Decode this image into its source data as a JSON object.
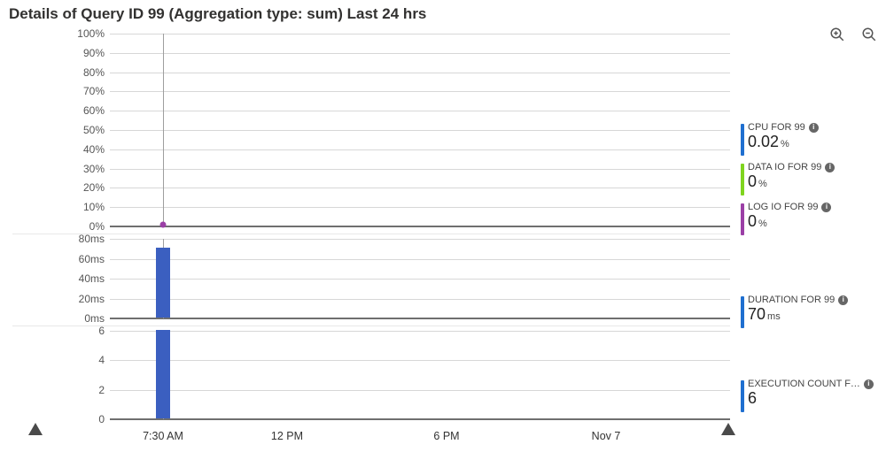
{
  "title": "Details of Query ID 99 (Aggregation type: sum) Last 24 hrs",
  "zoom_in_name": "zoom-in-icon",
  "zoom_out_name": "zoom-out-icon",
  "x_axis": {
    "labels": [
      "7:30 AM",
      "12 PM",
      "6 PM",
      "Nov 7"
    ]
  },
  "metrics": [
    {
      "label": "CPU FOR 99",
      "value": "0.02",
      "unit": "%",
      "color": "#1f6fd0"
    },
    {
      "label": "DATA IO FOR 99",
      "value": "0",
      "unit": "%",
      "color": "#7fd41e"
    },
    {
      "label": "LOG IO FOR 99",
      "value": "0",
      "unit": "%",
      "color": "#9b3fa6"
    },
    {
      "label": "DURATION FOR 99",
      "value": "70",
      "unit": "ms",
      "color": "#1f6fd0"
    },
    {
      "label": "EXECUTION COUNT F…",
      "value": "6",
      "unit": "",
      "color": "#1f6fd0"
    }
  ],
  "chart_data": [
    {
      "type": "line",
      "title": "Percent",
      "ylabel": "%",
      "ylim": [
        0,
        100
      ],
      "ticks": [
        "0%",
        "10%",
        "20%",
        "30%",
        "40%",
        "50%",
        "60%",
        "70%",
        "80%",
        "90%",
        "100%"
      ],
      "categories": [
        "7:30 AM"
      ],
      "series": [
        {
          "name": "CPU FOR 99",
          "values": [
            0.02
          ],
          "color": "#1f6fd0"
        },
        {
          "name": "DATA IO FOR 99",
          "values": [
            0
          ],
          "color": "#7fd41e"
        },
        {
          "name": "LOG IO FOR 99",
          "values": [
            0
          ],
          "color": "#9b3fa6"
        }
      ]
    },
    {
      "type": "bar",
      "title": "Duration",
      "ylabel": "ms",
      "ylim": [
        0,
        80
      ],
      "ticks": [
        "0ms",
        "20ms",
        "40ms",
        "60ms",
        "80ms"
      ],
      "categories": [
        "7:30 AM"
      ],
      "series": [
        {
          "name": "DURATION FOR 99",
          "values": [
            70
          ],
          "color": "#3b5fc0"
        }
      ]
    },
    {
      "type": "bar",
      "title": "Execution Count",
      "ylabel": "",
      "ylim": [
        0,
        6
      ],
      "ticks": [
        "0",
        "2",
        "4",
        "6"
      ],
      "categories": [
        "7:30 AM"
      ],
      "series": [
        {
          "name": "EXECUTION COUNT FOR 99",
          "values": [
            6
          ],
          "color": "#3b5fc0"
        }
      ]
    }
  ]
}
